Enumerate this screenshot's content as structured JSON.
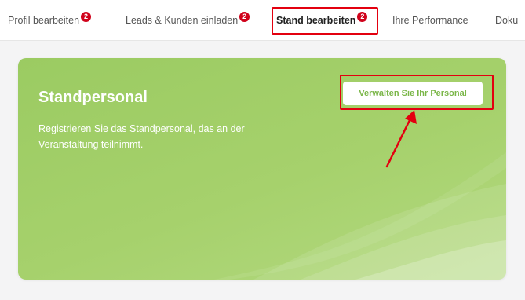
{
  "tabs": [
    {
      "label": "Profil bearbeiten",
      "badge": "2",
      "active": false
    },
    {
      "label": "Leads & Kunden einladen",
      "badge": "2",
      "active": false
    },
    {
      "label": "Stand bearbeiten",
      "badge": "2",
      "active": true
    },
    {
      "label": "Ihre Performance",
      "active": false
    },
    {
      "label": "Doku",
      "active": false
    }
  ],
  "card": {
    "title": "Standpersonal",
    "description": "Registrieren Sie das Standpersonal, das an der Veranstaltung teilnimmt.",
    "button_label": "Verwalten Sie Ihr Personal"
  },
  "colors": {
    "card_green": "#a6d16c",
    "highlight_red": "#e3000f",
    "badge_red": "#d0021b",
    "button_text_green": "#7ab648"
  }
}
